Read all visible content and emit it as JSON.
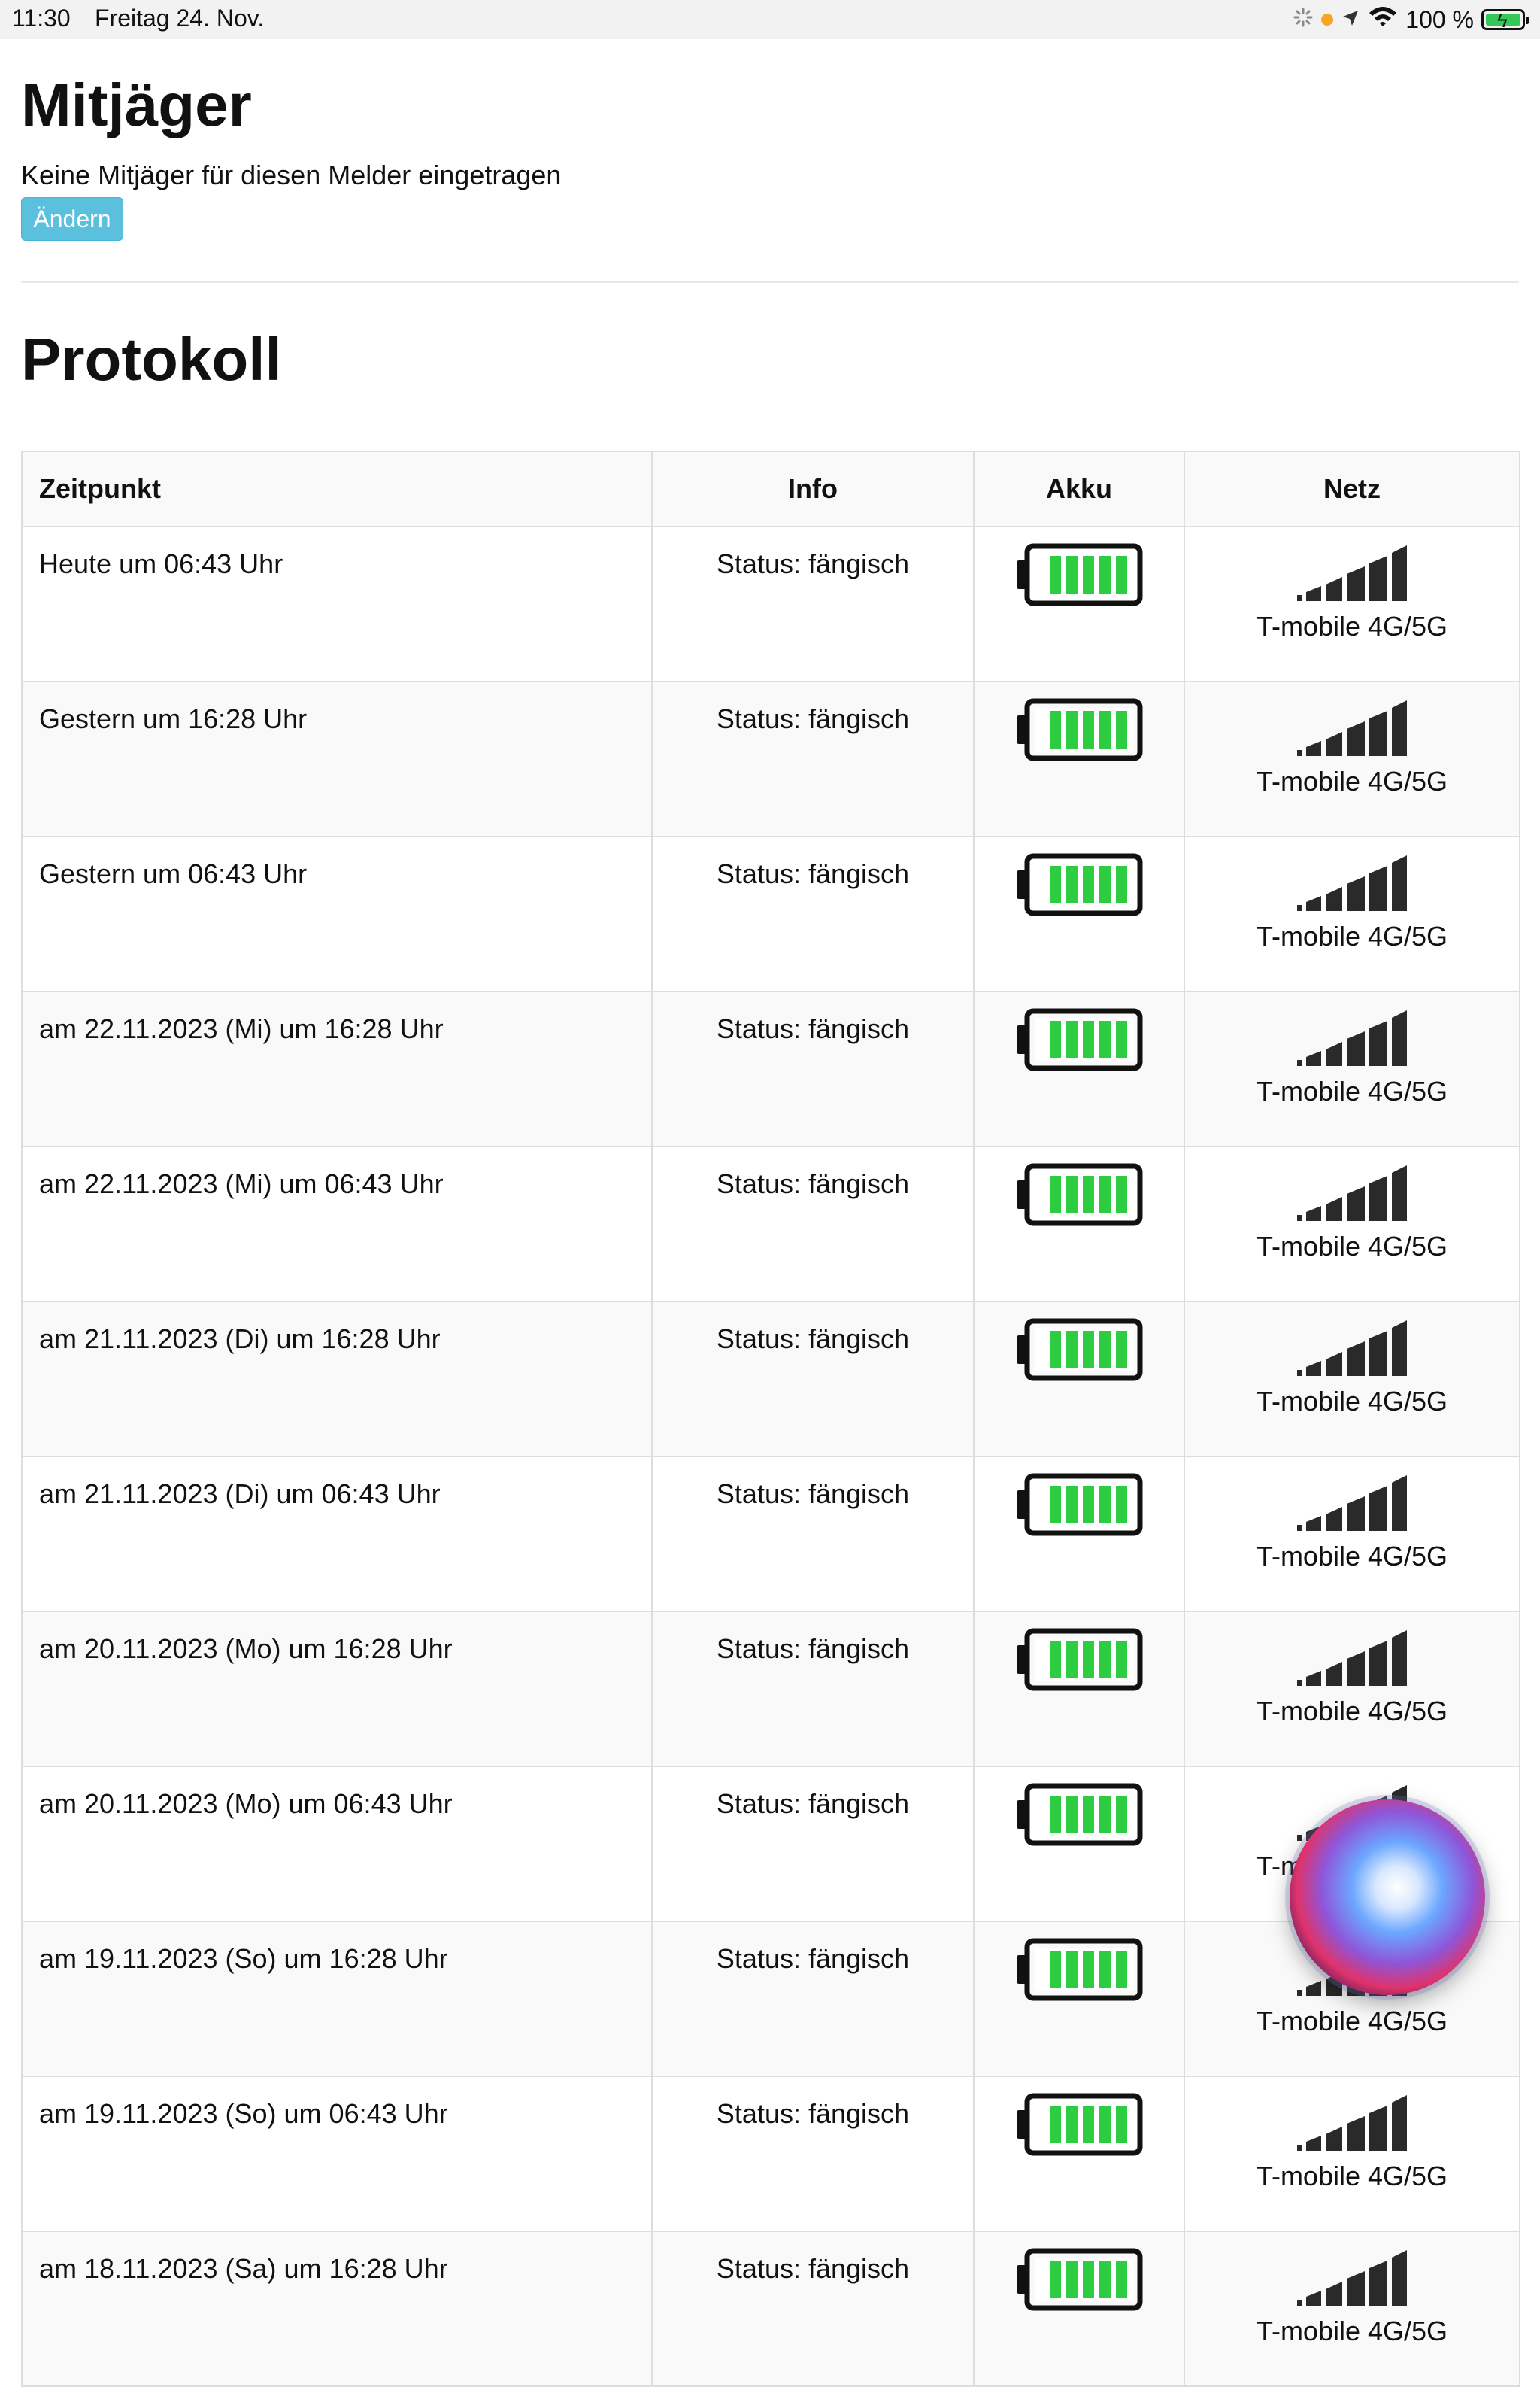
{
  "statusbar": {
    "time": "11:30",
    "date": "Freitag 24. Nov.",
    "battery_text": "100 %",
    "icons": [
      "activity-spinner-icon",
      "orange-dot-indicator",
      "location-arrow-icon",
      "wifi-icon",
      "battery-charging-icon"
    ]
  },
  "page": {
    "title": "Mitjäger",
    "subtitle": "Keine Mitjäger für diesen Melder eingetragen",
    "edit_button": "Ändern",
    "section_title": "Protokoll"
  },
  "table": {
    "headers": [
      "Zeitpunkt",
      "Info",
      "Akku",
      "Netz"
    ],
    "rows": [
      {
        "zeitpunkt": "Heute um 06:43 Uhr",
        "info": "Status: fängisch",
        "akku_level": 1.0,
        "netz": "T-mobile 4G/5G",
        "signal_bars": 5
      },
      {
        "zeitpunkt": "Gestern um 16:28 Uhr",
        "info": "Status: fängisch",
        "akku_level": 1.0,
        "netz": "T-mobile 4G/5G",
        "signal_bars": 5
      },
      {
        "zeitpunkt": "Gestern um 06:43 Uhr",
        "info": "Status: fängisch",
        "akku_level": 1.0,
        "netz": "T-mobile 4G/5G",
        "signal_bars": 5
      },
      {
        "zeitpunkt": "am 22.11.2023 (Mi) um 16:28 Uhr",
        "info": "Status: fängisch",
        "akku_level": 1.0,
        "netz": "T-mobile 4G/5G",
        "signal_bars": 5
      },
      {
        "zeitpunkt": "am 22.11.2023 (Mi) um 06:43 Uhr",
        "info": "Status: fängisch",
        "akku_level": 1.0,
        "netz": "T-mobile 4G/5G",
        "signal_bars": 5
      },
      {
        "zeitpunkt": "am 21.11.2023 (Di) um 16:28 Uhr",
        "info": "Status: fängisch",
        "akku_level": 1.0,
        "netz": "T-mobile 4G/5G",
        "signal_bars": 5
      },
      {
        "zeitpunkt": "am 21.11.2023 (Di) um 06:43 Uhr",
        "info": "Status: fängisch",
        "akku_level": 1.0,
        "netz": "T-mobile 4G/5G",
        "signal_bars": 5
      },
      {
        "zeitpunkt": "am 20.11.2023 (Mo) um 16:28 Uhr",
        "info": "Status: fängisch",
        "akku_level": 1.0,
        "netz": "T-mobile 4G/5G",
        "signal_bars": 5
      },
      {
        "zeitpunkt": "am 20.11.2023 (Mo) um 06:43 Uhr",
        "info": "Status: fängisch",
        "akku_level": 1.0,
        "netz": "T-mobile 4G/5G",
        "signal_bars": 5
      },
      {
        "zeitpunkt": "am 19.11.2023 (So) um 16:28 Uhr",
        "info": "Status: fängisch",
        "akku_level": 1.0,
        "netz": "T-mobile 4G/5G",
        "signal_bars": 5
      },
      {
        "zeitpunkt": "am 19.11.2023 (So) um 06:43 Uhr",
        "info": "Status: fängisch",
        "akku_level": 1.0,
        "netz": "T-mobile 4G/5G",
        "signal_bars": 5
      },
      {
        "zeitpunkt": "am 18.11.2023 (Sa) um 16:28 Uhr",
        "info": "Status: fängisch",
        "akku_level": 1.0,
        "netz": "T-mobile 4G/5G",
        "signal_bars": 5
      }
    ]
  },
  "colors": {
    "button_bg": "#5bc0de",
    "battery_fill": "#35c759",
    "cell_green": "#2ecc40",
    "table_border": "#dddddd",
    "stripe": "#f9f9f9"
  },
  "overlay": {
    "siri": "siri-orb-icon"
  }
}
